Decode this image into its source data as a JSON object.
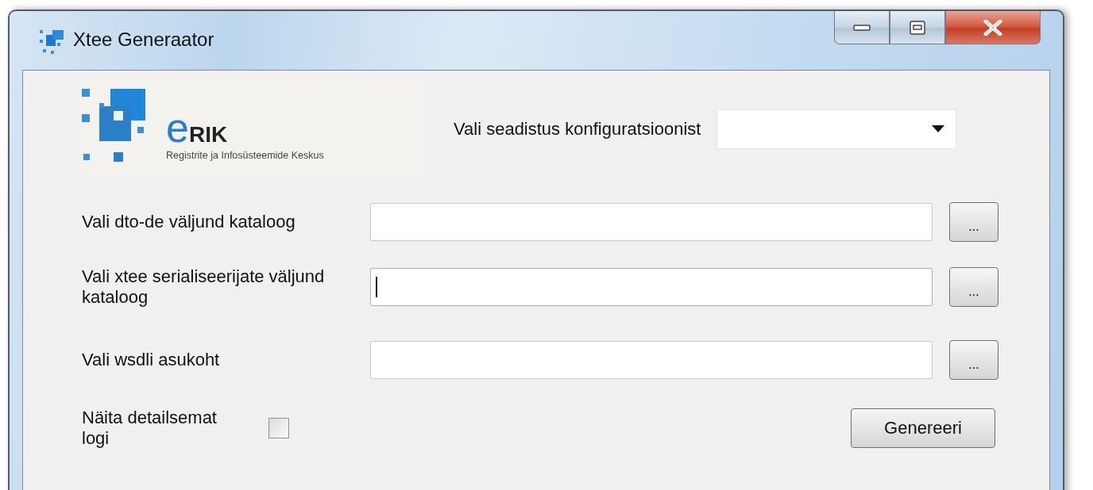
{
  "window": {
    "title": "Xtee Generaator"
  },
  "logo": {
    "wordmark": "eRIK",
    "subtitle": "Registrite ja Infosüsteemide Keskus"
  },
  "config": {
    "label": "Vali seadistus konfiguratsioonist"
  },
  "paths": [
    {
      "label": "Vali dto-de väljund kataloog",
      "focused": false,
      "browse": "..."
    },
    {
      "label": "Vali xtee serialiseerijate väljund kataloog",
      "focused": true,
      "browse": "..."
    },
    {
      "label": "Vali wsdli asukoht",
      "focused": false,
      "browse": "..."
    }
  ],
  "verbose": {
    "label": "Näita detailsemat logi",
    "checked": false
  },
  "generate_button": "Genereeri"
}
